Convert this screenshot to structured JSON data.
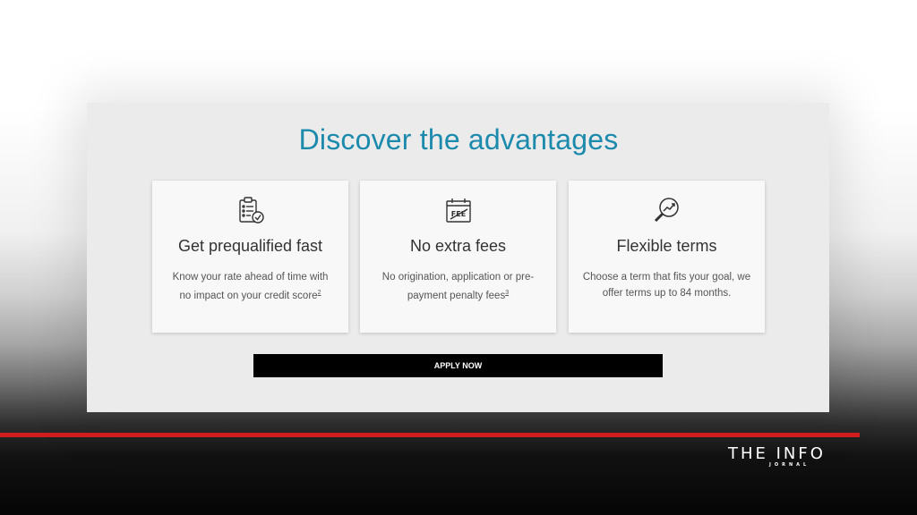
{
  "section": {
    "title": "Discover the advantages",
    "cards": [
      {
        "icon": "checklist-icon",
        "heading": "Get prequalified fast",
        "desc_line1": "Know your rate ahead of time with",
        "desc_line2": "no impact on your credit score",
        "footnote": "2"
      },
      {
        "icon": "fee-calendar-icon",
        "heading": "No extra fees",
        "desc_line1": "No origination, application or pre-",
        "desc_line2": "payment penalty fees",
        "footnote": "3"
      },
      {
        "icon": "growth-magnifier-icon",
        "heading": "Flexible terms",
        "desc_line1": "Choose a term that fits your goal, we",
        "desc_line2": "offer terms up to 84 months."
      }
    ],
    "button_label": "APPLY NOW"
  },
  "watermark": {
    "title": "THE INFO",
    "subtitle": "JORNAL"
  },
  "colors": {
    "accent": "#1b8aac",
    "brand_red": "#d11d1d",
    "button_bg": "#000000"
  }
}
